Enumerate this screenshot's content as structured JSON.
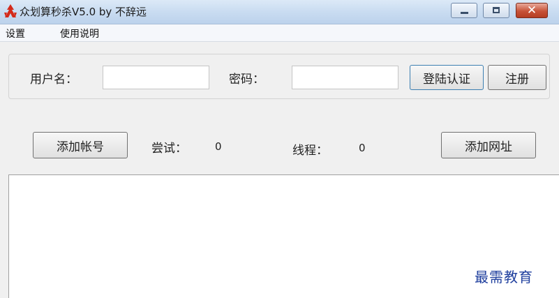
{
  "window": {
    "title": "众划算秒杀V5.0 by 不辞远",
    "close_glyph": "✕"
  },
  "menu": {
    "items": [
      "设置",
      "使用说明"
    ]
  },
  "login": {
    "username_label": "用户名：",
    "username_value": "",
    "password_label": "密码：",
    "password_value": "",
    "login_button": "登陆认证",
    "register_button": "注册"
  },
  "stats": {
    "add_account_button": "添加帐号",
    "attempts_label": "尝试：",
    "attempts_value": "0",
    "threads_label": "线程：",
    "threads_value": "0",
    "add_url_button": "添加网址"
  },
  "log": {
    "content": ""
  },
  "watermark": "最需教育",
  "colors": {
    "titlebar": "#c9dcf1",
    "close_button": "#c75238",
    "watermark": "#1f3f9e",
    "logo": "#d42a1a"
  }
}
